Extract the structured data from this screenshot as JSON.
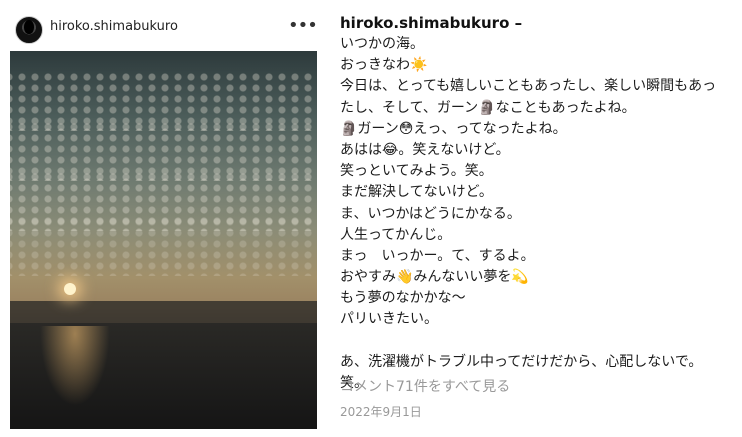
{
  "post": {
    "username": "hiroko.shimabukuro",
    "more_icon": "more-horizontal-icon",
    "photo_alt": ""
  },
  "caption": {
    "username": "hiroko.shimabukuro –",
    "lines": [
      "いつかの海。",
      "おっきなわ☀️",
      "今日は、とっても嬉しいこともあったし、楽しい瞬間もあっ",
      "たし、そして、ガーン🗿なこともあったよね。",
      "🗿ガーン😳えっ、ってなったよね。",
      "あはは😂。笑えないけど。",
      "笑っといてみよう。笑。",
      "まだ解決してないけど。",
      "ま、いつかはどうにかなる。",
      "人生ってかんじ。",
      "まっ　いっかー。て、するよ。",
      "おやすみ👋みんないい夢を💫",
      "もう夢のなかかな〜",
      "パリいきたい。",
      "",
      "あ、洗濯機がトラブル中ってだけだから、心配しないで。",
      "笑。"
    ]
  },
  "comments_link": "コメント71件をすべて見る",
  "date": "2022年9月1日"
}
